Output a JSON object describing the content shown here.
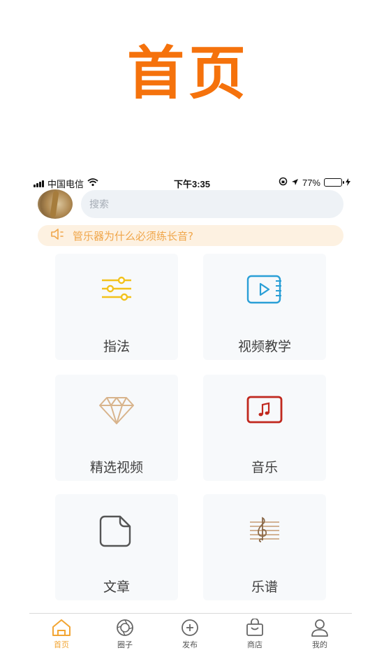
{
  "hero": {
    "title": "首页"
  },
  "status_bar": {
    "carrier": "中国电信",
    "time": "下午3:35",
    "battery": "77%",
    "battery_level": 0.77
  },
  "search": {
    "placeholder": "搜索"
  },
  "notice": {
    "text": "管乐器为什么必须练长音?"
  },
  "grid": {
    "items": [
      {
        "label": "指法",
        "icon": "sliders-icon"
      },
      {
        "label": "视频教学",
        "icon": "video-play-icon"
      },
      {
        "label": "精选视频",
        "icon": "diamond-icon"
      },
      {
        "label": "音乐",
        "icon": "music-note-icon"
      },
      {
        "label": "文章",
        "icon": "document-icon"
      },
      {
        "label": "乐谱",
        "icon": "music-staff-icon"
      }
    ]
  },
  "tabbar": {
    "items": [
      {
        "label": "首页",
        "icon": "home-icon",
        "active": true
      },
      {
        "label": "圈子",
        "icon": "aperture-icon",
        "active": false
      },
      {
        "label": "发布",
        "icon": "plus-circle-icon",
        "active": false
      },
      {
        "label": "商店",
        "icon": "shopping-bag-icon",
        "active": false
      },
      {
        "label": "我的",
        "icon": "user-icon",
        "active": false
      }
    ]
  },
  "colors": {
    "accent": "#f5720c",
    "tab_active": "#f2a533",
    "notice_text": "#f0a64a",
    "sliders_icon": "#f2c21c",
    "video_icon": "#2a9fd6",
    "diamond_icon": "#d8b48c",
    "music_icon": "#c0281e",
    "document_icon": "#555555",
    "staff_icon": "#c69a72"
  }
}
